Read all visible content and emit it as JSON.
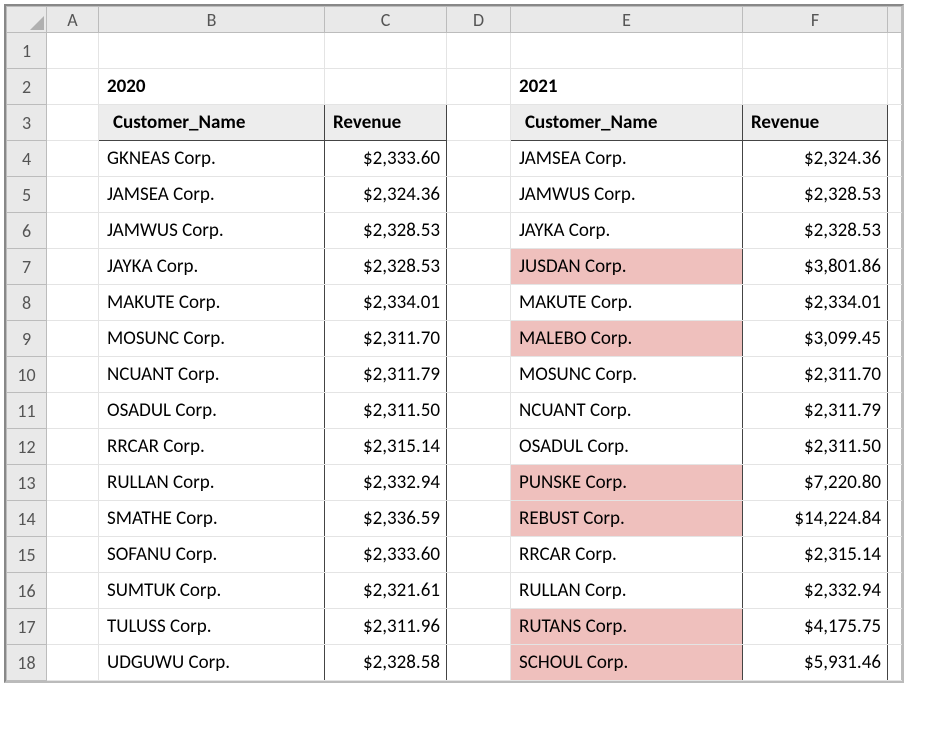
{
  "columns": [
    "A",
    "B",
    "C",
    "D",
    "E",
    "F"
  ],
  "row_numbers": [
    "1",
    "2",
    "3",
    "4",
    "5",
    "6",
    "7",
    "8",
    "9",
    "10",
    "11",
    "12",
    "13",
    "14",
    "15",
    "16",
    "17",
    "18"
  ],
  "left": {
    "year": "2020",
    "headers": {
      "name": "Customer_Name",
      "rev": "Revenue"
    },
    "rows": [
      {
        "name": "GKNEAS Corp.",
        "rev": "$2,333.60"
      },
      {
        "name": "JAMSEA Corp.",
        "rev": "$2,324.36"
      },
      {
        "name": "JAMWUS Corp.",
        "rev": "$2,328.53"
      },
      {
        "name": "JAYKA Corp.",
        "rev": "$2,328.53"
      },
      {
        "name": "MAKUTE Corp.",
        "rev": "$2,334.01"
      },
      {
        "name": "MOSUNC Corp.",
        "rev": "$2,311.70"
      },
      {
        "name": "NCUANT Corp.",
        "rev": "$2,311.79"
      },
      {
        "name": "OSADUL Corp.",
        "rev": "$2,311.50"
      },
      {
        "name": "RRCAR Corp.",
        "rev": "$2,315.14"
      },
      {
        "name": "RULLAN Corp.",
        "rev": "$2,332.94"
      },
      {
        "name": "SMATHE Corp.",
        "rev": "$2,336.59"
      },
      {
        "name": "SOFANU Corp.",
        "rev": "$2,333.60"
      },
      {
        "name": "SUMTUK Corp.",
        "rev": "$2,321.61"
      },
      {
        "name": "TULUSS Corp.",
        "rev": "$2,311.96"
      },
      {
        "name": "UDGUWU Corp.",
        "rev": "$2,328.58"
      }
    ]
  },
  "right": {
    "year": "2021",
    "headers": {
      "name": "Customer_Name",
      "rev": "Revenue"
    },
    "rows": [
      {
        "name": "JAMSEA Corp.",
        "rev": "$2,324.36",
        "hl": false
      },
      {
        "name": "JAMWUS Corp.",
        "rev": "$2,328.53",
        "hl": false
      },
      {
        "name": "JAYKA Corp.",
        "rev": "$2,328.53",
        "hl": false
      },
      {
        "name": "JUSDAN Corp.",
        "rev": "$3,801.86",
        "hl": true
      },
      {
        "name": "MAKUTE Corp.",
        "rev": "$2,334.01",
        "hl": false
      },
      {
        "name": "MALEBO Corp.",
        "rev": "$3,099.45",
        "hl": true
      },
      {
        "name": "MOSUNC Corp.",
        "rev": "$2,311.70",
        "hl": false
      },
      {
        "name": "NCUANT Corp.",
        "rev": "$2,311.79",
        "hl": false
      },
      {
        "name": "OSADUL Corp.",
        "rev": "$2,311.50",
        "hl": false
      },
      {
        "name": "PUNSKE Corp.",
        "rev": "$7,220.80",
        "hl": true
      },
      {
        "name": "REBUST Corp.",
        "rev": "$14,224.84",
        "hl": true
      },
      {
        "name": "RRCAR Corp.",
        "rev": "$2,315.14",
        "hl": false
      },
      {
        "name": "RULLAN Corp.",
        "rev": "$2,332.94",
        "hl": false
      },
      {
        "name": "RUTANS Corp.",
        "rev": "$4,175.75",
        "hl": true
      },
      {
        "name": "SCHOUL Corp.",
        "rev": "$5,931.46",
        "hl": true
      }
    ]
  }
}
